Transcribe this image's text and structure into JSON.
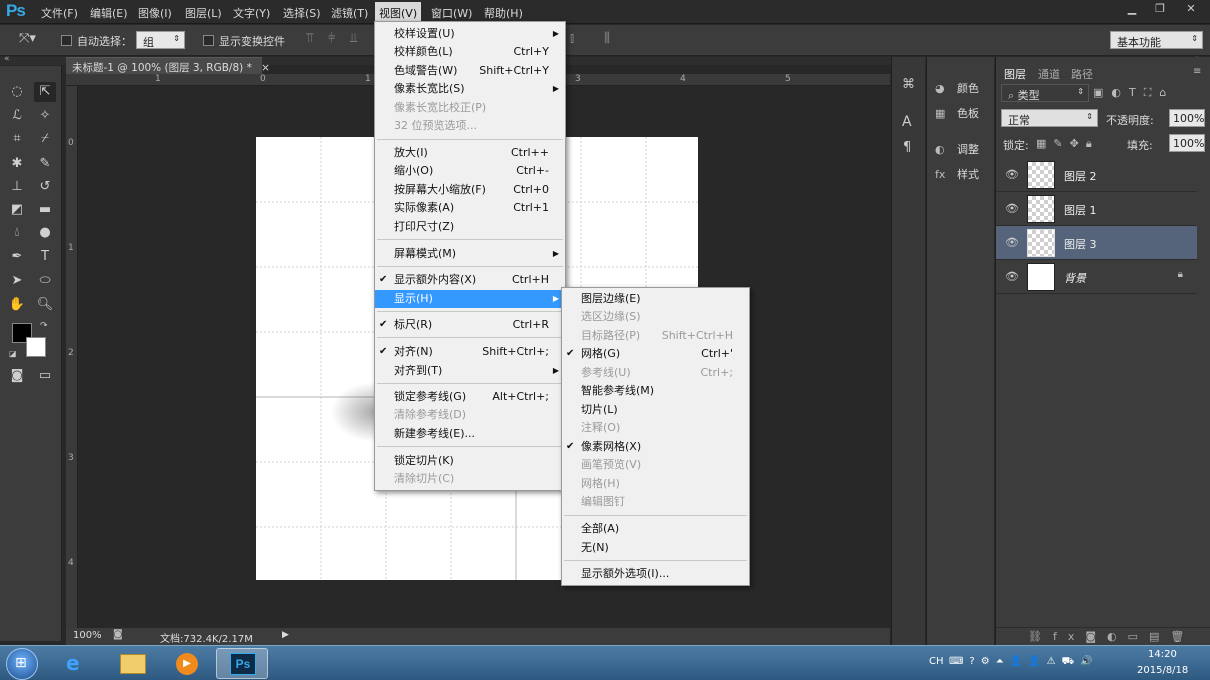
{
  "app": {
    "logo": "Ps"
  },
  "menubar": {
    "items": [
      "文件(F)",
      "编辑(E)",
      "图像(I)",
      "图层(L)",
      "文字(Y)",
      "选择(S)",
      "滤镜(T)",
      "视图(V)",
      "窗口(W)",
      "帮助(H)"
    ],
    "open": "视图(V)",
    "window_buttons": [
      "minimize",
      "restore",
      "close"
    ]
  },
  "options": {
    "auto_select_label": "自动选择：",
    "auto_select_value": "组",
    "transform_label": "显示变换控件",
    "workspace": "基本功能"
  },
  "document": {
    "tab_title": "未标题-1 @ 100% (图层 3, RGB/8) *",
    "tab_close": "×",
    "zoom": "100%",
    "doc_info": "文档:732.4K/2.17M",
    "ruler_h": [
      "1",
      "0",
      "1",
      "2",
      "3",
      "4",
      "5"
    ],
    "ruler_v": [
      "0",
      "1",
      "2",
      "3",
      "4"
    ]
  },
  "view_menu": {
    "items": [
      {
        "label": "校样设置(U)",
        "sub": true
      },
      {
        "label": "校样颜色(L)",
        "shortcut": "Ctrl+Y"
      },
      {
        "label": "色域警告(W)",
        "shortcut": "Shift+Ctrl+Y"
      },
      {
        "label": "像素长宽比(S)",
        "sub": true
      },
      {
        "label": "像素长宽比校正(P)",
        "disabled": true
      },
      {
        "label": "32 位预览选项...",
        "disabled": true
      },
      {
        "label": "放大(I)",
        "shortcut": "Ctrl++"
      },
      {
        "label": "缩小(O)",
        "shortcut": "Ctrl+-"
      },
      {
        "label": "按屏幕大小缩放(F)",
        "shortcut": "Ctrl+0"
      },
      {
        "label": "实际像素(A)",
        "shortcut": "Ctrl+1"
      },
      {
        "label": "打印尺寸(Z)"
      },
      {
        "label": "屏幕模式(M)",
        "sub": true
      },
      {
        "label": "显示额外内容(X)",
        "shortcut": "Ctrl+H",
        "checked": true
      },
      {
        "label": "显示(H)",
        "sub": true,
        "highlighted": true
      },
      {
        "label": "标尺(R)",
        "shortcut": "Ctrl+R",
        "checked": true
      },
      {
        "label": "对齐(N)",
        "shortcut": "Shift+Ctrl+;",
        "checked": true
      },
      {
        "label": "对齐到(T)",
        "sub": true
      },
      {
        "label": "锁定参考线(G)",
        "shortcut": "Alt+Ctrl+;"
      },
      {
        "label": "清除参考线(D)",
        "disabled": true
      },
      {
        "label": "新建参考线(E)..."
      },
      {
        "label": "锁定切片(K)"
      },
      {
        "label": "清除切片(C)",
        "disabled": true
      }
    ]
  },
  "show_submenu": {
    "items": [
      {
        "label": "图层边缘(E)"
      },
      {
        "label": "选区边缘(S)",
        "disabled": true
      },
      {
        "label": "目标路径(P)",
        "shortcut": "Shift+Ctrl+H",
        "disabled": true
      },
      {
        "label": "网格(G)",
        "shortcut": "Ctrl+'",
        "checked": true
      },
      {
        "label": "参考线(U)",
        "shortcut": "Ctrl+;",
        "disabled": true
      },
      {
        "label": "智能参考线(M)"
      },
      {
        "label": "切片(L)"
      },
      {
        "label": "注释(O)",
        "disabled": true
      },
      {
        "label": "像素网格(X)",
        "checked": true
      },
      {
        "label": "画笔预览(V)",
        "disabled": true
      },
      {
        "label": "网格(H)",
        "disabled": true
      },
      {
        "label": "编辑图钉",
        "disabled": true
      },
      {
        "label": "全部(A)"
      },
      {
        "label": "无(N)"
      },
      {
        "label": "显示额外选项(I)..."
      }
    ]
  },
  "mini_panel": {
    "items": [
      {
        "label": "颜色",
        "icon": "color-icon"
      },
      {
        "label": "色板",
        "icon": "swatches-icon"
      },
      {
        "label": "调整",
        "icon": "adjust-icon"
      },
      {
        "label": "样式",
        "icon": "styles-icon"
      }
    ]
  },
  "layers_panel": {
    "tabs": [
      "图层",
      "通道",
      "路径"
    ],
    "filter": "类型",
    "blend_mode": "正常",
    "opacity_label": "不透明度:",
    "opacity": "100%",
    "lock_label": "锁定:",
    "fill_label": "填充:",
    "fill": "100%",
    "layers": [
      {
        "name": "图层 2",
        "selected": false
      },
      {
        "name": "图层 1",
        "selected": false
      },
      {
        "name": "图层 3",
        "selected": true
      },
      {
        "name": "背景",
        "selected": false,
        "locked": true
      }
    ]
  },
  "taskbar": {
    "time": "14:20",
    "date": "2015/8/18",
    "lang": "CH",
    "active_app": "Ps"
  }
}
